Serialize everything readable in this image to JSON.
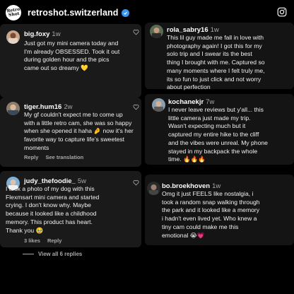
{
  "header": {
    "account": "retroshot.switzerland",
    "logo_text": "Retro Shot"
  },
  "comments": [
    {
      "username": "big.foxy",
      "time": "1w",
      "lines": [
        "Just got my mini camera today and",
        "I'm already OBSESSED. Took it out",
        "during golden hour and the pics",
        "came out so dreamy 💛"
      ]
    },
    {
      "username": "tiger.hum16",
      "time": "2w",
      "lines": [
        "My gf couldn't expect me to come up",
        "with a little retro cam, she was so happy",
        "when she opened it haha 🤌 now it's her",
        "favorite way to capture life's sweetest",
        "moments"
      ],
      "actions": {
        "reply": "Reply",
        "translate": "See translation"
      }
    },
    {
      "username": "judy_thefoodie_",
      "time": "5w",
      "lines": [
        "I took a photo of my dog with this",
        "Flexmsart mini camera and started",
        "crying. I don't know why. Maybe",
        "because it looked like a childhood",
        "memory. This product has heart.",
        "Thank you 🥹"
      ],
      "actions": {
        "likes": "3 likes",
        "reply": "Reply"
      }
    },
    {
      "username": "rola_sabry16",
      "time": "1w",
      "lines": [
        "This lil guy made me fall in love with",
        "photography again! I got this for my",
        "solo trip and I swear its the best",
        "thing I brought with me. Captured so",
        "many moments where I felt truly me,",
        "its so fun to just click and not worry",
        "about perfection"
      ]
    },
    {
      "username": "kochanekjr",
      "time": "7w",
      "lines": [
        "I never leave reviews but y'all... this",
        "little camera just made my trip.",
        "Wasn't expecting much but it",
        "captured my entire hike to the cliff",
        "and the vibes were unreal. My phone",
        "stayed in my backpack the whole",
        "time. 🔥🔥🔥"
      ]
    },
    {
      "username": "bo.broekhoven",
      "time": "1w",
      "lines": [
        "Omg it just FEELS like nostalgia, i",
        "took a random snap walking through",
        "the park and it looked like a memory",
        "i hadn't even lived yet. Who knew a",
        "tiny cam could make me this",
        "emotional 😭💗"
      ]
    }
  ],
  "view_all": "View all 6 replies",
  "icons": {
    "heart": "heart-icon",
    "verified": "verified-badge-icon",
    "instagram": "instagram-icon"
  }
}
